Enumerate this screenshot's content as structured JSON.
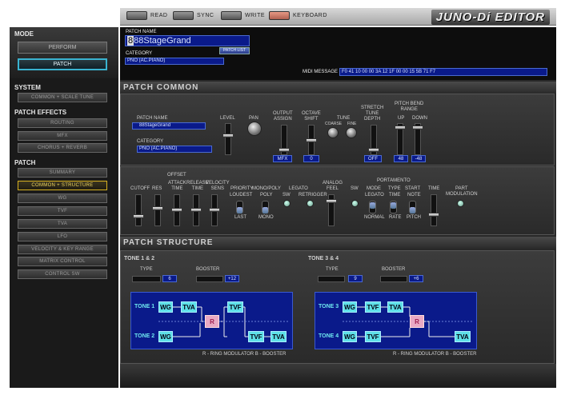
{
  "toolbar": {
    "read": "READ",
    "sync": "SYNC",
    "write": "WRITE",
    "keyboard": "KEYBOARD",
    "logo": "JUNO-Di EDITOR"
  },
  "mode": {
    "title": "MODE",
    "perform": "PERFORM",
    "patch": "PATCH"
  },
  "system": {
    "title": "SYSTEM",
    "common_scale_tune": "COMMON + SCALE TUNE"
  },
  "patch_effects": {
    "title": "PATCH EFFECTS",
    "routing": "ROUTING",
    "mfx": "MFX",
    "chorus_reverb": "CHORUS + REVERB"
  },
  "patch_nav": {
    "title": "PATCH",
    "items": [
      "SUMMARY",
      "COMMON + STRUCTURE",
      "WG",
      "TVF",
      "TVA",
      "LFO",
      "VELOCITY & KEY RANGE",
      "MATRIX CONTROL",
      "CONTROL SW"
    ]
  },
  "info": {
    "patch_name_label": "PATCH NAME",
    "patch_number": "8",
    "patch_name": "88StageGrand",
    "patch_list": "PATCH LIST",
    "category_label": "CATEGORY",
    "category": "PNO (AC.PIANO)",
    "midi_label": "MIDI MESSAGE",
    "midi": "F0 41 10 00 00 3A 12 1F 00 00 15 5B 71 F7"
  },
  "common": {
    "title": "PATCH COMMON",
    "patch_name_label": "PATCH NAME",
    "patch_name": "88StageGrand",
    "category_label": "CATEGORY",
    "category": "PNO (AC.PIANO)",
    "level": "LEVEL",
    "pan": "PAN",
    "output_assign": "OUTPUT\nASSIGN",
    "output_value": "MFX",
    "octave_shift": "OCTAVE\nSHIFT",
    "octave_value": "0",
    "tune": "TUNE",
    "coarse": "COARSE",
    "fine": "FINE",
    "stretch": "STRETCH\nTUNE\nDEPTH",
    "stretch_value": "OFF",
    "pitch_bend": "PITCH BEND\nRANGE",
    "up": "UP",
    "down": "DOWN",
    "up_value": "48",
    "down_value": "-48"
  },
  "offset": {
    "title": "OFFSET",
    "cutoff": "CUTOFF",
    "res": "RES",
    "attack": "ATTACK\nTIME",
    "release": "RELEASE\nTIME",
    "velocity": "VELOCITY\nSENS",
    "priority": "PRIORITY",
    "loudest": "LOUDEST",
    "last": "LAST",
    "monopoly": "MONO/POLY",
    "poly": "POLY",
    "mono": "MONO",
    "legato": "LEGATO",
    "sw": "SW",
    "retrigger": "RETRIGGER",
    "analog": "ANALOG\nFEEL",
    "portamento": "PORTAMENTO",
    "p_sw": "SW",
    "mode": "MODE",
    "legato2": "LEGATO",
    "normal": "NORMAL",
    "type": "TYPE",
    "time": "TIME",
    "rate": "RATE",
    "start": "START",
    "note": "NOTE",
    "pitch": "PITCH",
    "time2": "TIME",
    "part_mod": "PART\nMODULATION"
  },
  "structure": {
    "title": "PATCH STRUCTURE",
    "t12": "TONE 1 & 2",
    "t34": "TONE 3 & 4",
    "type": "TYPE",
    "booster": "BOOSTER",
    "type12": "6",
    "booster12": "+12",
    "type34": "9",
    "booster34": "+6",
    "tone1": "TONE 1",
    "tone2": "TONE 2",
    "tone3": "TONE 3",
    "tone4": "TONE 4",
    "wg": "WG",
    "tva": "TVA",
    "tvf": "TVF",
    "r": "R",
    "legend": "R - RING MODULATOR    B - BOOSTER"
  }
}
